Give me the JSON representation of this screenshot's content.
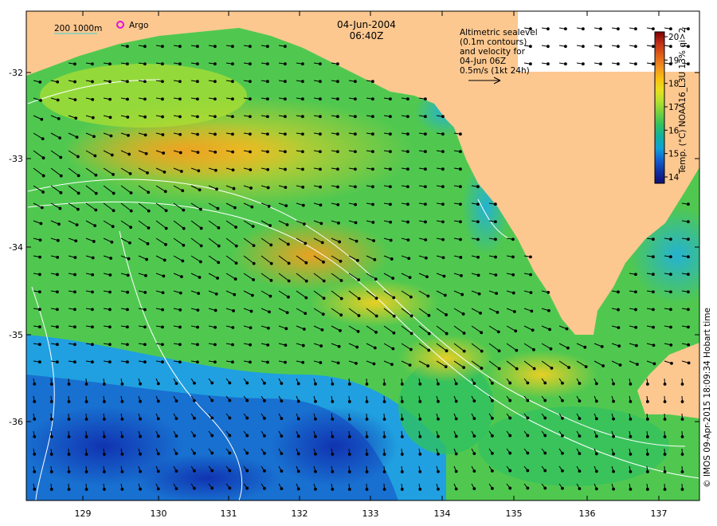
{
  "header": {
    "date": "04-Jun-2004",
    "time": "06:40Z"
  },
  "legend": {
    "bathymetry_label": "200  1000m",
    "argo_label": "Argo"
  },
  "altimetry_note": {
    "line1": "Altimetric sealevel",
    "line2": "(0.1m contours)",
    "line3": "and velocity for",
    "line4": "04-Jun 06Z",
    "line5": "0.5m/s (1kt 24h)"
  },
  "colorbar": {
    "title": "Temp. (°C) NOAA16_L3U 13% qi>2",
    "ticks": [
      "20",
      "19",
      "18",
      "17",
      "16",
      "15",
      "14"
    ],
    "stops": [
      "#7a0000",
      "#c0301a",
      "#e06018",
      "#f09020",
      "#f8c010",
      "#e8e020",
      "#b0e030",
      "#70d040",
      "#30c060",
      "#10b0a0",
      "#10a0d8",
      "#1060d0",
      "#1030a0",
      "#101070"
    ]
  },
  "axes": {
    "lon_ticks": [
      "129",
      "130",
      "131",
      "132",
      "133",
      "134",
      "135",
      "136",
      "137"
    ],
    "lat_ticks": [
      "-32",
      "-33",
      "-34",
      "-35",
      "-36"
    ]
  },
  "credit": "© IMOS 09-Apr-2015 18:09:34 Hobart time",
  "colors": {
    "land": "#fcc890",
    "frame": "#000000",
    "contour": "#ffffff",
    "argo_marker": "#e010e0",
    "bathymetry_line": "#40d0d0"
  }
}
